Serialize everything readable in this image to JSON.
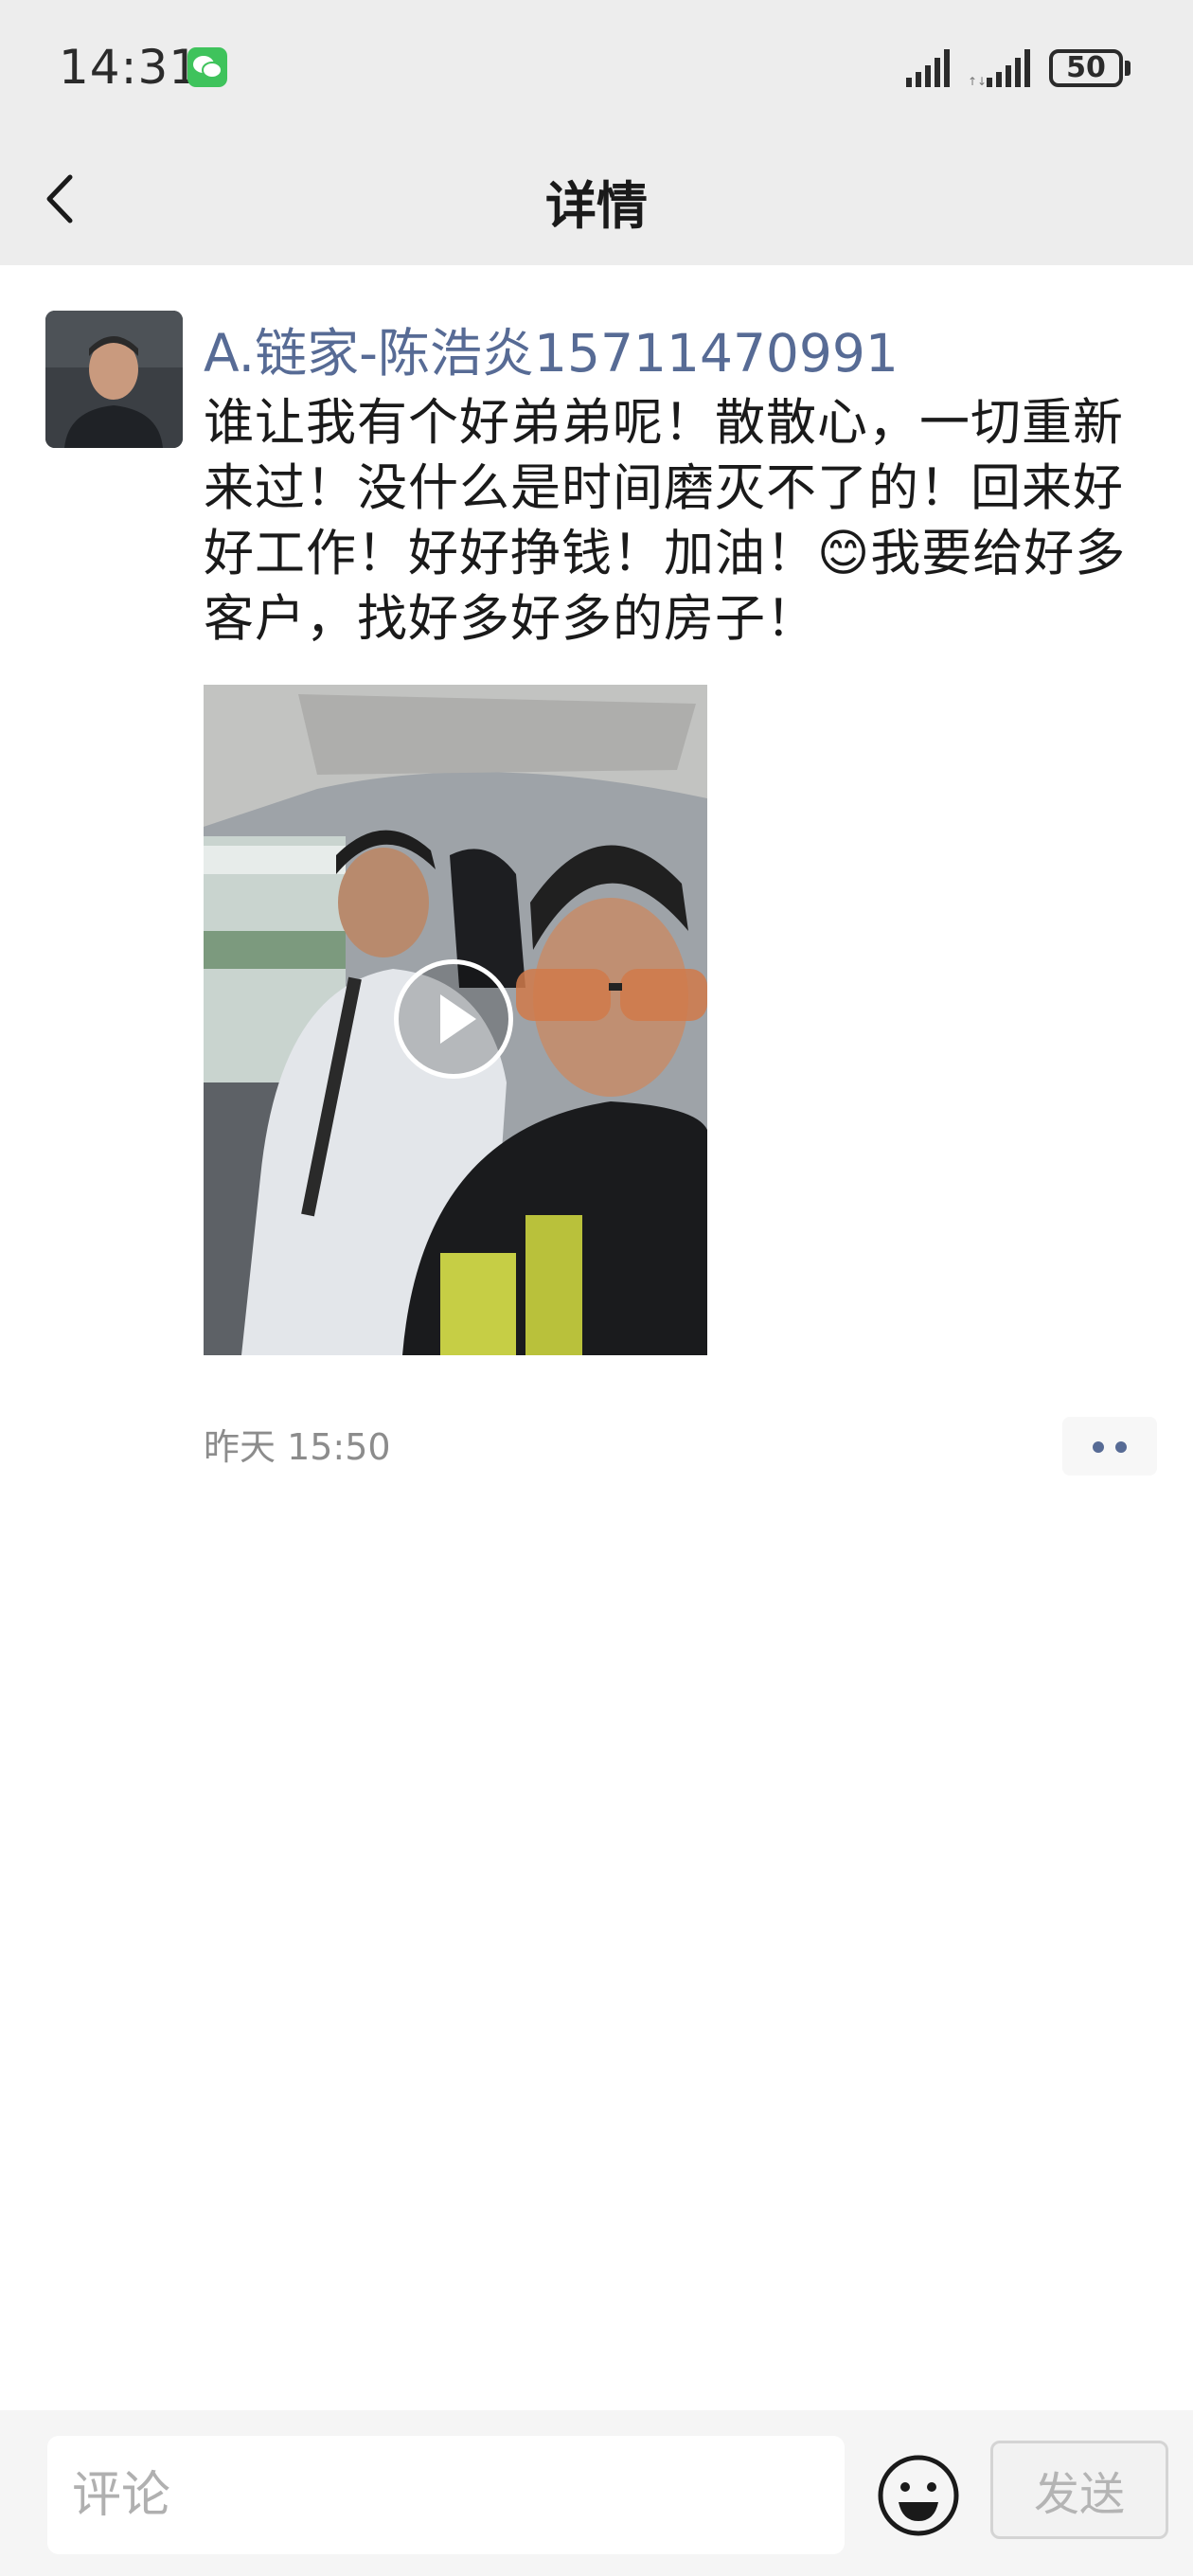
{
  "status_bar": {
    "time": "14:31",
    "battery": "50",
    "notification_icon": "wechat-icon"
  },
  "nav": {
    "title": "详情",
    "back_icon": "chevron-left-icon"
  },
  "post": {
    "author": "A.链家-陈浩炎15711470991",
    "text_part1": "谁让我有个好弟弟呢！散散心，一切重新来过！没什么是时间磨灭不了的！回来好好工作！好好挣钱！加油！",
    "emoji": "😊",
    "text_part2": "我要给好多客户，找好多好多的房子！",
    "timestamp": "昨天 15:50",
    "media_type": "video"
  },
  "comment_bar": {
    "placeholder": "评论",
    "send_label": "发送"
  },
  "colors": {
    "header_bg": "#ededed",
    "link_blue": "#576b95",
    "text": "#1a1a1a",
    "muted": "#8c8c8c"
  }
}
